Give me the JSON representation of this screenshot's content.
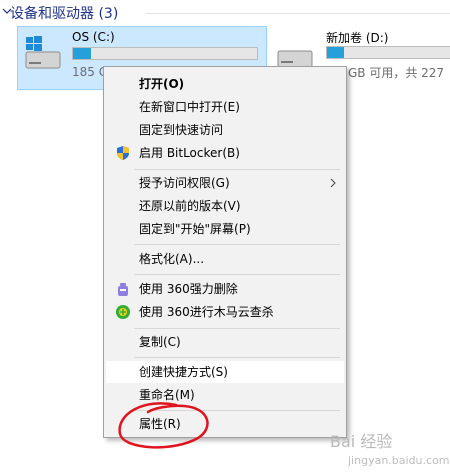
{
  "section": {
    "title": "设备和驱动器 (3)"
  },
  "drives": [
    {
      "name": "OS (C:)",
      "info": "185 G",
      "fill_fraction": 0.1,
      "selected": true
    },
    {
      "name": "新加卷 (D:)",
      "info": "GB 可用，共 227",
      "fill_fraction": 0.13,
      "selected": false
    }
  ],
  "context_menu": {
    "items": [
      {
        "label": "打开(O)",
        "bold": true
      },
      {
        "label": "在新窗口中打开(E)"
      },
      {
        "label": "固定到快速访问"
      },
      {
        "label": "启用 BitLocker(B)",
        "icon": "shield-icon"
      },
      {
        "label": "授予访问权限(G)",
        "submenu": true
      },
      {
        "label": "还原以前的版本(V)"
      },
      {
        "label": "固定到\"开始\"屏幕(P)"
      },
      {
        "label": "格式化(A)..."
      },
      {
        "label": "使用 360强力删除",
        "icon": "360-delete-icon"
      },
      {
        "label": "使用 360进行木马云查杀",
        "icon": "360-scan-icon"
      },
      {
        "label": "复制(C)"
      },
      {
        "label": "创建快捷方式(S)",
        "highlighted": true
      },
      {
        "label": "重命名(M)"
      },
      {
        "label": "属性(R)"
      }
    ]
  },
  "watermark": {
    "text": "Bai 经验",
    "sub": "jingyan.baidu.com"
  },
  "colors": {
    "accent": "#26a0da",
    "selection": "#cce8ff",
    "annotation": "#e0141e"
  }
}
